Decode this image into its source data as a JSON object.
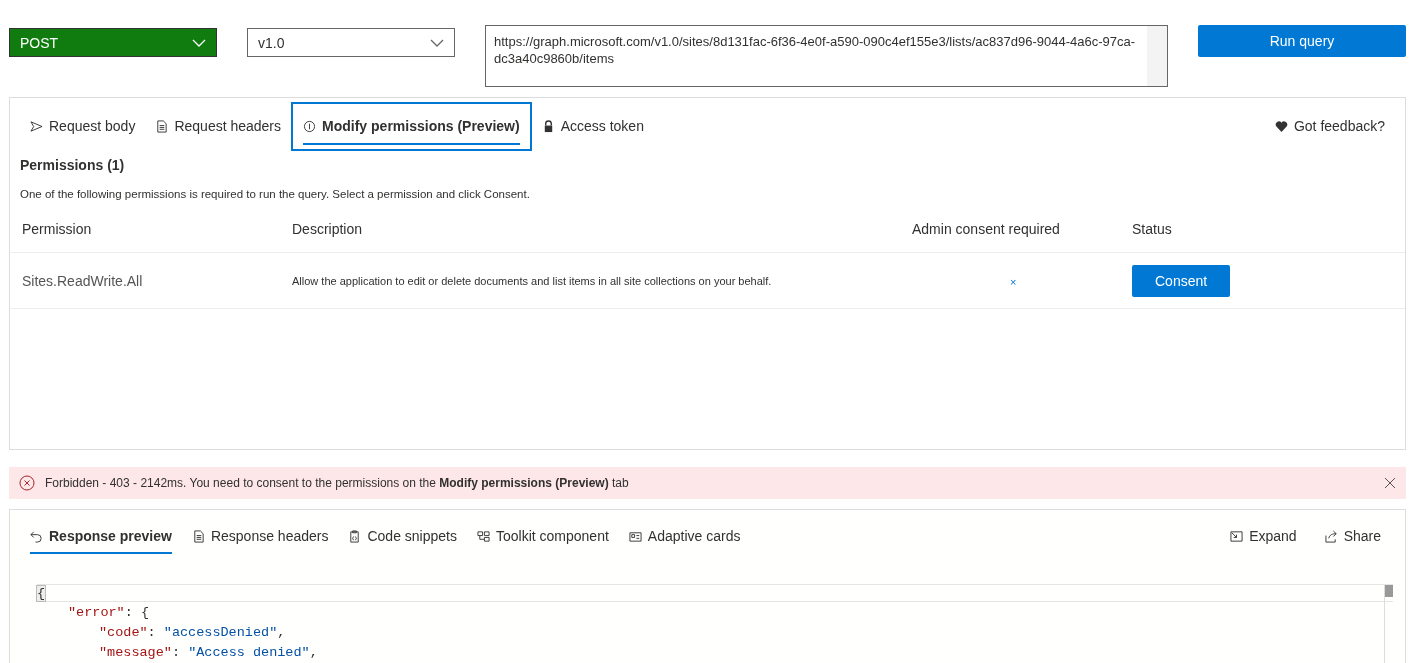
{
  "query": {
    "method": "POST",
    "version": "v1.0",
    "url": "https://graph.microsoft.com/v1.0/sites/8d131fac-6f36-4e0f-a590-090c4ef155e3/lists/ac837d96-9044-4a6c-97ca-dc3a40c9860b/items",
    "run_button": "Run query"
  },
  "request_tabs": [
    {
      "label": "Request body",
      "selected": false
    },
    {
      "label": "Request headers",
      "selected": false
    },
    {
      "label": "Modify permissions (Preview)",
      "selected": true
    },
    {
      "label": "Access token",
      "selected": false
    }
  ],
  "feedback": "Got feedback?",
  "permissions": {
    "title": "Permissions (1)",
    "note": "One of the following permissions is required to run the query. Select a permission and click Consent.",
    "columns": [
      "Permission",
      "Description",
      "Admin consent required",
      "Status"
    ],
    "rows": [
      {
        "permission": "Sites.ReadWrite.All",
        "description": "Allow the application to edit or delete documents and list items in all site collections on your behalf.",
        "admin_consent": "×",
        "action": "Consent"
      }
    ]
  },
  "error_bar": {
    "message": "Forbidden - 403 - 2142ms. You need to consent to the permissions on the **Modify permissions (Preview)** tab"
  },
  "response_tabs": [
    {
      "label": "Response preview",
      "selected": true
    },
    {
      "label": "Response headers",
      "selected": false
    },
    {
      "label": "Code snippets",
      "selected": false
    },
    {
      "label": "Toolkit component",
      "selected": false
    },
    {
      "label": "Adaptive cards",
      "selected": false
    }
  ],
  "response_actions": [
    "Expand",
    "Share"
  ],
  "response_body": {
    "open": "{",
    "children": [
      {
        "key": "\"error\"",
        "sep": ": {",
        "children": [
          {
            "key": "\"code\"",
            "sep": ": ",
            "value": "\"accessDenied\"",
            "end": ","
          },
          {
            "key": "\"message\"",
            "sep": ": ",
            "value": "\"Access denied\"",
            "end": ","
          }
        ]
      }
    ]
  }
}
